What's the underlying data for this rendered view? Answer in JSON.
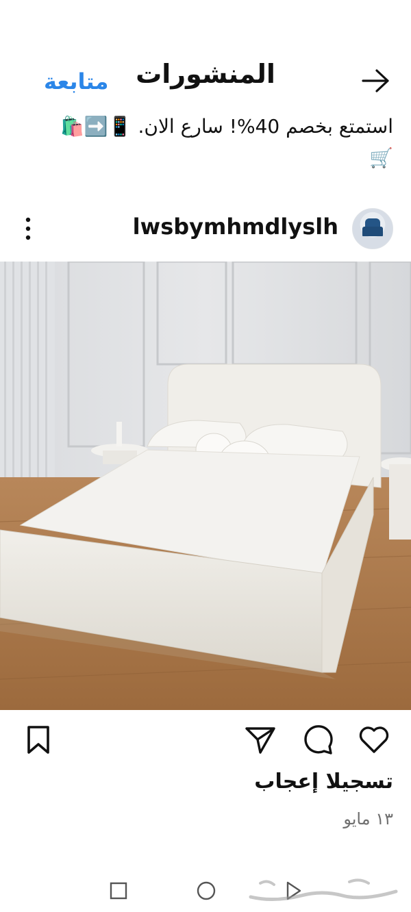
{
  "header": {
    "title": "المنشورات",
    "follow_label": "متابعة"
  },
  "post": {
    "caption_text": "استمتع بخصم 40%! سارع الان.",
    "caption_emojis": "📱➡️🛍️",
    "caption_emoji_cart": "🛒",
    "username": "lwsbymhmdlyslh",
    "likes_text": "تسجيلا إعجاب",
    "date": "١٣ مايو"
  },
  "icons": [
    "back-arrow-icon",
    "more-vertical-icon",
    "heart-icon",
    "comment-icon",
    "share-icon",
    "bookmark-icon",
    "recent-apps-icon",
    "home-icon",
    "back-icon"
  ],
  "colors": {
    "accent": "#2b86e8",
    "text": "#111111",
    "muted": "#6f6f6f"
  }
}
